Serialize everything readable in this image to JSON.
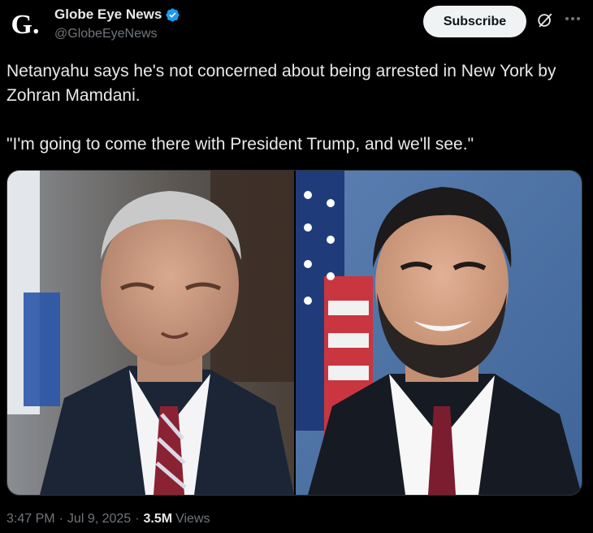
{
  "account": {
    "name": "Globe Eye News",
    "handle": "@GlobeEyeNews",
    "avatar_letter": "G."
  },
  "header": {
    "subscribe_label": "Subscribe"
  },
  "post": {
    "text": "Netanyahu says he's not concerned about being arrested in New York by Zohran Mamdani.\n\n\"I'm going to come there with President Trump, and we'll see.\"",
    "time": "3:47 PM",
    "date": "Jul 9, 2025",
    "views_count": "3.5M",
    "views_label": "Views"
  },
  "colors": {
    "verified": "#1d9bf0",
    "background": "#000000",
    "text_primary": "#e7e9ea",
    "text_secondary": "#71767b"
  }
}
